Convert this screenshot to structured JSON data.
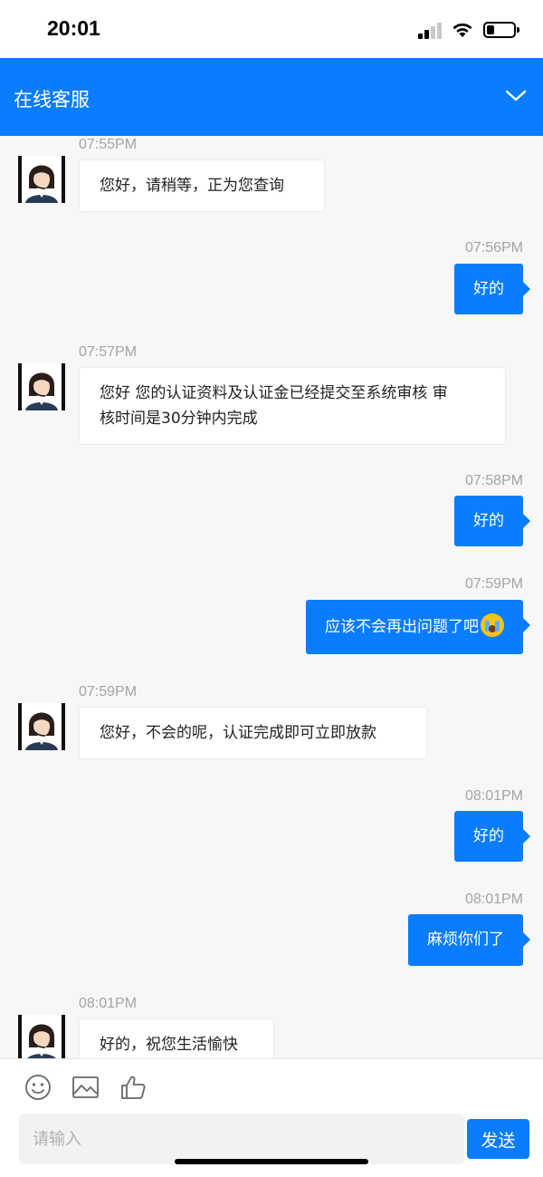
{
  "status_bar": {
    "time": "20:01"
  },
  "header": {
    "title": "在线客服"
  },
  "messages": [
    {
      "from": "agent",
      "time": "07:55PM",
      "text": "您好，请稍等，正为您查询"
    },
    {
      "from": "user",
      "time": "07:56PM",
      "text": "好的"
    },
    {
      "from": "agent",
      "time": "07:57PM",
      "lines": [
        "您好 您的认证资料及认证金已经提交至系统审核 审",
        "核时间是30分钟内完成"
      ]
    },
    {
      "from": "user",
      "time": "07:58PM",
      "text": "好的"
    },
    {
      "from": "user",
      "time": "07:59PM",
      "text": "应该不会再出问题了吧",
      "emoji": "crying-face"
    },
    {
      "from": "agent",
      "time": "07:59PM",
      "text": "您好，不会的呢，认证完成即可立即放款"
    },
    {
      "from": "user",
      "time": "08:01PM",
      "text": "好的"
    },
    {
      "from": "user",
      "time": "08:01PM",
      "text": "麻烦你们了"
    },
    {
      "from": "agent",
      "time": "08:01PM",
      "text": "好的，祝您生活愉快"
    }
  ],
  "composer": {
    "placeholder": "请输入",
    "send_label": "发送"
  },
  "colors": {
    "accent": "#0a7cff",
    "background": "#f7f7f8"
  }
}
